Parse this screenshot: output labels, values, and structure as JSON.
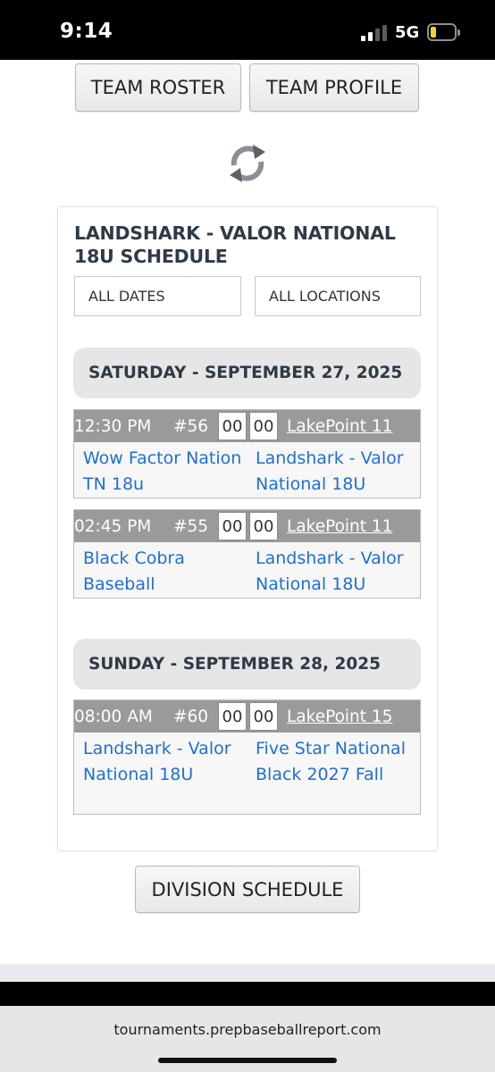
{
  "status_bar": {
    "time": "9:14",
    "network": "5G"
  },
  "buttons": {
    "team_roster": "TEAM ROSTER",
    "team_profile": "TEAM PROFILE",
    "division_schedule": "DIVISION SCHEDULE"
  },
  "schedule": {
    "title": "LANDSHARK - VALOR NATIONAL 18U SCHEDULE",
    "filters": {
      "dates": "ALL DATES",
      "locations": "ALL LOCATIONS"
    },
    "days": [
      {
        "label": "SATURDAY - SEPTEMBER 27, 2025",
        "games": [
          {
            "time": "12:30 PM",
            "number": "#56",
            "score_a": "00",
            "score_b": "00",
            "location": "LakePoint 11",
            "team_a": "Wow Factor Nation TN 18u",
            "team_b": "Landshark - Valor National 18U"
          },
          {
            "time": "02:45 PM",
            "number": "#55",
            "score_a": "00",
            "score_b": "00",
            "location": "LakePoint 11",
            "team_a": "Black Cobra Baseball",
            "team_b": "Landshark - Valor National 18U"
          }
        ]
      },
      {
        "label": "SUNDAY - SEPTEMBER 28, 2025",
        "games": [
          {
            "time": "08:00 AM",
            "number": "#60",
            "score_a": "00",
            "score_b": "00",
            "location": "LakePoint 15",
            "team_a": "Landshark - Valor National 18U",
            "team_b": "Five Star National Black 2027 Fall"
          }
        ]
      }
    ]
  },
  "browser": {
    "url": "tournaments.prepbaseballreport.com"
  },
  "icons": {
    "refresh": "refresh-icon",
    "signal": "signal-icon",
    "battery": "battery-icon"
  },
  "colors": {
    "link": "#1f6fd1",
    "title": "#2e3a47",
    "game_bar": "#9a9a9a",
    "battery": "#f5d22b"
  }
}
